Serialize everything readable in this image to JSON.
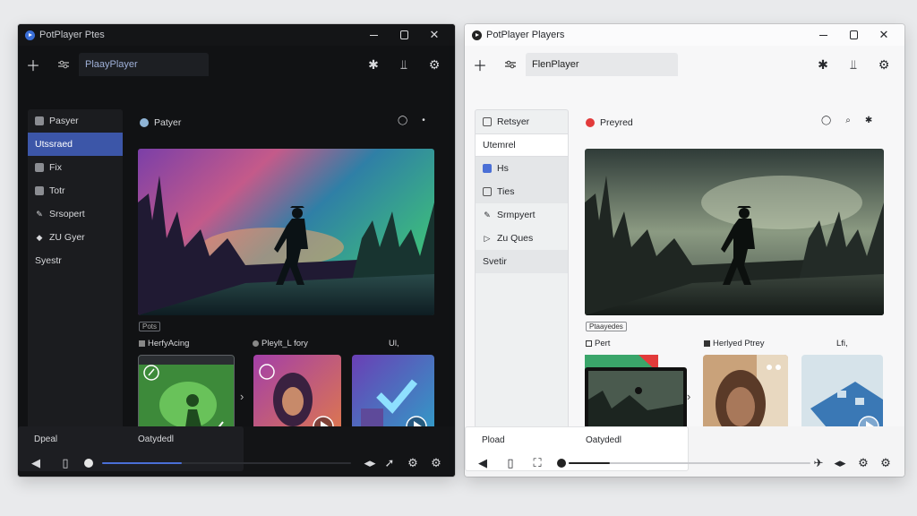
{
  "left_window": {
    "title": "PotPlayer Ptes",
    "toolbar_tab": "PlaayPlayer",
    "sidebar": [
      "Pasyer",
      "Utssraed",
      "Fix",
      "Totr",
      "Srsopert",
      "ZU Gyer",
      "Syestr"
    ],
    "header_title": "Patyer",
    "chip": "Pots",
    "thumb_labels": [
      "HerfyAcing",
      "Pleylt_L fory",
      "Ul,"
    ],
    "bottom_label_1": "Dpeal",
    "bottom_label_2": "Oatydedl",
    "progress": 0.32,
    "accent": "#3c56a8"
  },
  "right_window": {
    "title": "PotPlayer Players",
    "toolbar_tab": "FlenPlayer",
    "sidebar": [
      "Retsyer",
      "Utemrel",
      "Hs",
      "Ties",
      "Srmpyert",
      "Zu Ques",
      "Svetir"
    ],
    "header_title": "Preyred",
    "chip": "Ptaayedes",
    "thumb_labels": [
      "Pert",
      "Herlyed Ptrey",
      "Lfi,"
    ],
    "bottom_label_1": "Pload",
    "bottom_label_2": "Oatydedl",
    "progress": 0.17,
    "accent": "#e23b3b"
  }
}
